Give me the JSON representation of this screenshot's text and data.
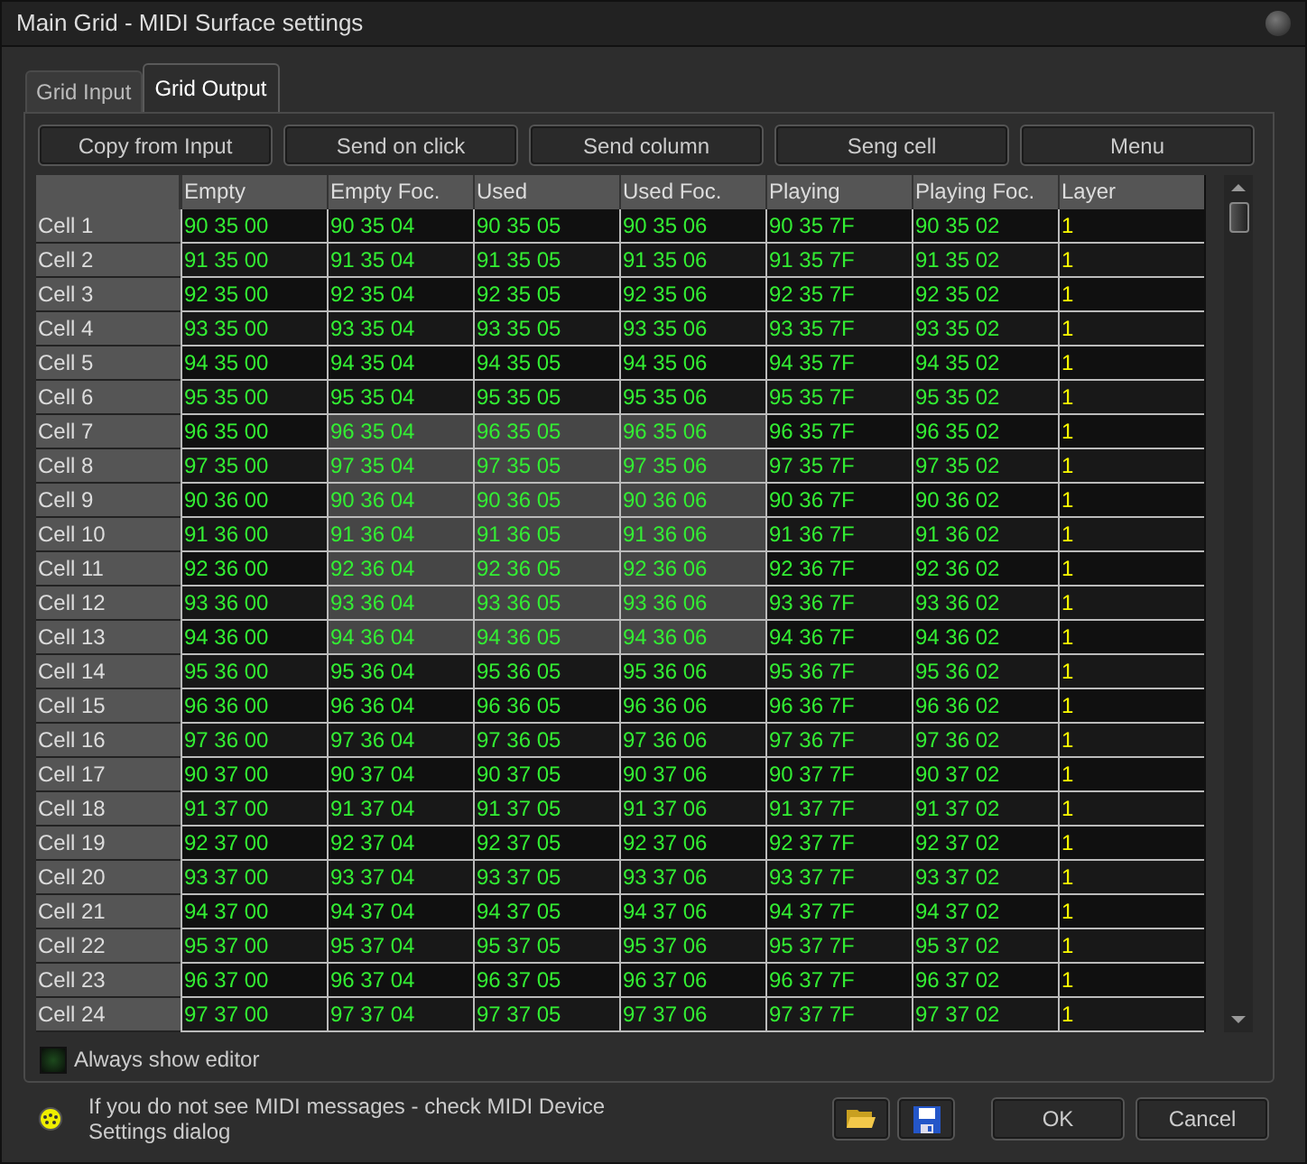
{
  "window": {
    "title": "Main Grid - MIDI Surface settings"
  },
  "tabs": [
    {
      "label": "Grid Input",
      "selected": false
    },
    {
      "label": "Grid Output",
      "selected": true
    }
  ],
  "toolbar": [
    "Copy from Input",
    "Send on click",
    "Send column",
    "Seng cell",
    "Menu"
  ],
  "table": {
    "columns": [
      {
        "label": "Empty",
        "selected": false
      },
      {
        "label": "Empty Foc.",
        "selected": true
      },
      {
        "label": "Used",
        "selected": true
      },
      {
        "label": "Used Foc.",
        "selected": true
      },
      {
        "label": "Playing",
        "selected": false
      },
      {
        "label": "Playing Foc.",
        "selected": false
      },
      {
        "label": "Layer",
        "selected": false
      }
    ],
    "rows": [
      {
        "label": "Cell 1",
        "selected": false,
        "cells": [
          "90 35 00",
          "90 35 04",
          "90 35 05",
          "90 35 06",
          "90 35 7F",
          "90 35 02",
          "1"
        ]
      },
      {
        "label": "Cell 2",
        "selected": false,
        "cells": [
          "91 35 00",
          "91 35 04",
          "91 35 05",
          "91 35 06",
          "91 35 7F",
          "91 35 02",
          "1"
        ]
      },
      {
        "label": "Cell 3",
        "selected": false,
        "cells": [
          "92 35 00",
          "92 35 04",
          "92 35 05",
          "92 35 06",
          "92 35 7F",
          "92 35 02",
          "1"
        ]
      },
      {
        "label": "Cell 4",
        "selected": false,
        "cells": [
          "93 35 00",
          "93 35 04",
          "93 35 05",
          "93 35 06",
          "93 35 7F",
          "93 35 02",
          "1"
        ]
      },
      {
        "label": "Cell 5",
        "selected": false,
        "cells": [
          "94 35 00",
          "94 35 04",
          "94 35 05",
          "94 35 06",
          "94 35 7F",
          "94 35 02",
          "1"
        ]
      },
      {
        "label": "Cell 6",
        "selected": false,
        "cells": [
          "95 35 00",
          "95 35 04",
          "95 35 05",
          "95 35 06",
          "95 35 7F",
          "95 35 02",
          "1"
        ]
      },
      {
        "label": "Cell 7",
        "selected": true,
        "cells": [
          "96 35 00",
          "96 35 04",
          "96 35 05",
          "96 35 06",
          "96 35 7F",
          "96 35 02",
          "1"
        ]
      },
      {
        "label": "Cell 8",
        "selected": true,
        "cells": [
          "97 35 00",
          "97 35 04",
          "97 35 05",
          "97 35 06",
          "97 35 7F",
          "97 35 02",
          "1"
        ]
      },
      {
        "label": "Cell 9",
        "selected": true,
        "cells": [
          "90 36 00",
          "90 36 04",
          "90 36 05",
          "90 36 06",
          "90 36 7F",
          "90 36 02",
          "1"
        ]
      },
      {
        "label": "Cell 10",
        "selected": true,
        "cells": [
          "91 36 00",
          "91 36 04",
          "91 36 05",
          "91 36 06",
          "91 36 7F",
          "91 36 02",
          "1"
        ]
      },
      {
        "label": "Cell 11",
        "selected": true,
        "cells": [
          "92 36 00",
          "92 36 04",
          "92 36 05",
          "92 36 06",
          "92 36 7F",
          "92 36 02",
          "1"
        ]
      },
      {
        "label": "Cell 12",
        "selected": true,
        "cells": [
          "93 36 00",
          "93 36 04",
          "93 36 05",
          "93 36 06",
          "93 36 7F",
          "93 36 02",
          "1"
        ]
      },
      {
        "label": "Cell 13",
        "selected": true,
        "cells": [
          "94 36 00",
          "94 36 04",
          "94 36 05",
          "94 36 06",
          "94 36 7F",
          "94 36 02",
          "1"
        ]
      },
      {
        "label": "Cell 14",
        "selected": false,
        "cells": [
          "95 36 00",
          "95 36 04",
          "95 36 05",
          "95 36 06",
          "95 36 7F",
          "95 36 02",
          "1"
        ]
      },
      {
        "label": "Cell 15",
        "selected": false,
        "cells": [
          "96 36 00",
          "96 36 04",
          "96 36 05",
          "96 36 06",
          "96 36 7F",
          "96 36 02",
          "1"
        ]
      },
      {
        "label": "Cell 16",
        "selected": false,
        "cells": [
          "97 36 00",
          "97 36 04",
          "97 36 05",
          "97 36 06",
          "97 36 7F",
          "97 36 02",
          "1"
        ]
      },
      {
        "label": "Cell 17",
        "selected": false,
        "cells": [
          "90 37 00",
          "90 37 04",
          "90 37 05",
          "90 37 06",
          "90 37 7F",
          "90 37 02",
          "1"
        ]
      },
      {
        "label": "Cell 18",
        "selected": false,
        "cells": [
          "91 37 00",
          "91 37 04",
          "91 37 05",
          "91 37 06",
          "91 37 7F",
          "91 37 02",
          "1"
        ]
      },
      {
        "label": "Cell 19",
        "selected": false,
        "cells": [
          "92 37 00",
          "92 37 04",
          "92 37 05",
          "92 37 06",
          "92 37 7F",
          "92 37 02",
          "1"
        ]
      },
      {
        "label": "Cell 20",
        "selected": false,
        "cells": [
          "93 37 00",
          "93 37 04",
          "93 37 05",
          "93 37 06",
          "93 37 7F",
          "93 37 02",
          "1"
        ]
      },
      {
        "label": "Cell 21",
        "selected": false,
        "cells": [
          "94 37 00",
          "94 37 04",
          "94 37 05",
          "94 37 06",
          "94 37 7F",
          "94 37 02",
          "1"
        ]
      },
      {
        "label": "Cell 22",
        "selected": false,
        "cells": [
          "95 37 00",
          "95 37 04",
          "95 37 05",
          "95 37 06",
          "95 37 7F",
          "95 37 02",
          "1"
        ]
      },
      {
        "label": "Cell 23",
        "selected": false,
        "cells": [
          "96 37 00",
          "96 37 04",
          "96 37 05",
          "96 37 06",
          "96 37 7F",
          "96 37 02",
          "1"
        ]
      },
      {
        "label": "Cell 24",
        "selected": false,
        "cells": [
          "97 37 00",
          "97 37 04",
          "97 37 05",
          "97 37 06",
          "97 37 7F",
          "97 37 02",
          "1"
        ]
      }
    ]
  },
  "always_show_editor": {
    "label": "Always show editor",
    "checked": false
  },
  "hint": "If you do not see MIDI messages - check MIDI Device Settings dialog",
  "buttons": [
    "OK",
    "Cancel"
  ]
}
